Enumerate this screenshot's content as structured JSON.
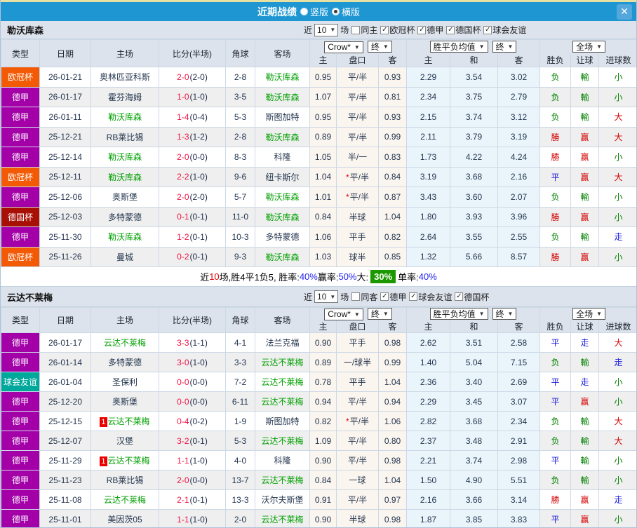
{
  "icons": {
    "dropdown_arrow": "▼",
    "check": "✓",
    "close": "✕"
  },
  "colors": {
    "titlebar": "#1e96d2",
    "badge": {
      "欧冠杯": "#f25a05",
      "德甲": "#a300a8",
      "德国杯": "#a91005",
      "球会友谊": "#00a79b"
    },
    "result": {
      "勝": "#d40000",
      "赢": "#d40000",
      "大": "#d40000",
      "平": "#2020dd",
      "走": "#2020dd",
      "负": "#008000",
      "輸": "#008000",
      "小": "#008000"
    }
  },
  "titlebar": {
    "title": "近期战绩",
    "radio_vertical": "竖版",
    "radio_horizontal": "横版"
  },
  "table_header": {
    "type": "类型",
    "date": "日期",
    "home": "主场",
    "score": "比分(半场)",
    "corner": "角球",
    "away": "客场",
    "dd_odds": "Crow*",
    "dd_final": "终",
    "dd_wdl": "胜平负均值",
    "dd_full": "全场",
    "sub_handicap": [
      "主",
      "盘口",
      "客"
    ],
    "sub_wdl": [
      "主",
      "和",
      "客"
    ],
    "sub_result": [
      "胜负",
      "让球",
      "进球数"
    ]
  },
  "sections": [
    {
      "team": "勒沃库森",
      "filter": {
        "recent": "近",
        "count": "10",
        "matches": "场",
        "checks": [
          {
            "label": "同主",
            "checked": false
          },
          {
            "label": "欧冠杯",
            "checked": true
          },
          {
            "label": "德甲",
            "checked": true
          },
          {
            "label": "德国杯",
            "checked": true
          },
          {
            "label": "球会友谊",
            "checked": true
          }
        ]
      },
      "rows": [
        {
          "comp": "欧冠杯",
          "date": "26-01-21",
          "home": "奥林匹亚科斯",
          "ft": "2-0",
          "ht": "2-0",
          "corner": "2-8",
          "away": "勒沃库森",
          "away_hl": true,
          "odds": [
            "0.95",
            "平/半",
            "0.93"
          ],
          "star": false,
          "eu": [
            "2.29",
            "3.54",
            "3.02"
          ],
          "res": [
            "负",
            "輸",
            "小"
          ]
        },
        {
          "comp": "德甲",
          "date": "26-01-17",
          "home": "霍芬海姆",
          "ft": "1-0",
          "ht": "1-0",
          "corner": "3-5",
          "away": "勒沃库森",
          "away_hl": true,
          "odds": [
            "1.07",
            "平/半",
            "0.81"
          ],
          "star": false,
          "eu": [
            "2.34",
            "3.75",
            "2.79"
          ],
          "res": [
            "负",
            "輸",
            "小"
          ]
        },
        {
          "comp": "德甲",
          "date": "26-01-11",
          "home": "勒沃库森",
          "home_hl": true,
          "ft": "1-4",
          "ht": "0-4",
          "corner": "5-3",
          "away": "斯图加特",
          "odds": [
            "0.95",
            "平/半",
            "0.93"
          ],
          "star": false,
          "eu": [
            "2.15",
            "3.74",
            "3.12"
          ],
          "res": [
            "负",
            "輸",
            "大"
          ]
        },
        {
          "comp": "德甲",
          "date": "25-12-21",
          "home": "RB莱比锡",
          "ft": "1-3",
          "ht": "1-2",
          "corner": "2-8",
          "away": "勒沃库森",
          "away_hl": true,
          "odds": [
            "0.89",
            "平/半",
            "0.99"
          ],
          "star": false,
          "eu": [
            "2.11",
            "3.79",
            "3.19"
          ],
          "res": [
            "勝",
            "赢",
            "大"
          ]
        },
        {
          "comp": "德甲",
          "date": "25-12-14",
          "home": "勒沃库森",
          "home_hl": true,
          "ft": "2-0",
          "ht": "0-0",
          "corner": "8-3",
          "away": "科隆",
          "odds": [
            "1.05",
            "半/一",
            "0.83"
          ],
          "star": false,
          "eu": [
            "1.73",
            "4.22",
            "4.24"
          ],
          "res": [
            "勝",
            "赢",
            "小"
          ]
        },
        {
          "comp": "欧冠杯",
          "date": "25-12-11",
          "home": "勒沃库森",
          "home_hl": true,
          "ft": "2-2",
          "ht": "1-0",
          "corner": "9-6",
          "away": "纽卡斯尔",
          "odds": [
            "1.04",
            "平/半",
            "0.84"
          ],
          "star": true,
          "eu": [
            "3.19",
            "3.68",
            "2.16"
          ],
          "res": [
            "平",
            "赢",
            "大"
          ]
        },
        {
          "comp": "德甲",
          "date": "25-12-06",
          "home": "奥斯堡",
          "ft": "2-0",
          "ht": "2-0",
          "corner": "5-7",
          "away": "勒沃库森",
          "away_hl": true,
          "odds": [
            "1.01",
            "平/半",
            "0.87"
          ],
          "star": true,
          "eu": [
            "3.43",
            "3.60",
            "2.07"
          ],
          "res": [
            "负",
            "輸",
            "小"
          ]
        },
        {
          "comp": "德国杯",
          "date": "25-12-03",
          "home": "多特蒙德",
          "ft": "0-1",
          "ht": "0-1",
          "corner": "11-0",
          "away": "勒沃库森",
          "away_hl": true,
          "odds": [
            "0.84",
            "半球",
            "1.04"
          ],
          "star": false,
          "eu": [
            "1.80",
            "3.93",
            "3.96"
          ],
          "res": [
            "勝",
            "赢",
            "小"
          ]
        },
        {
          "comp": "德甲",
          "date": "25-11-30",
          "home": "勒沃库森",
          "home_hl": true,
          "ft": "1-2",
          "ht": "0-1",
          "corner": "10-3",
          "away": "多特蒙德",
          "odds": [
            "1.06",
            "平手",
            "0.82"
          ],
          "star": false,
          "eu": [
            "2.64",
            "3.55",
            "2.55"
          ],
          "res": [
            "负",
            "輸",
            "走"
          ]
        },
        {
          "comp": "欧冠杯",
          "date": "25-11-26",
          "home": "曼城",
          "ft": "0-2",
          "ht": "0-1",
          "corner": "9-3",
          "away": "勒沃库森",
          "away_hl": true,
          "odds": [
            "1.03",
            "球半",
            "0.85"
          ],
          "star": false,
          "eu": [
            "1.32",
            "5.66",
            "8.57"
          ],
          "res": [
            "勝",
            "赢",
            "小"
          ]
        }
      ],
      "summary": [
        {
          "t": "近",
          "c": "k"
        },
        {
          "t": "10",
          "c": "r"
        },
        {
          "t": "场,胜4平1负5, 胜率:",
          "c": "k"
        },
        {
          "t": "40%",
          "c": "b"
        },
        {
          "t": " 赢率:",
          "c": "k"
        },
        {
          "t": "50%",
          "c": "b"
        },
        {
          "t": " 大:",
          "c": "k"
        },
        {
          "t": "30%",
          "c": "g"
        },
        {
          "t": " 单率:",
          "c": "k"
        },
        {
          "t": "40%",
          "c": "b"
        }
      ]
    },
    {
      "team": "云达不莱梅",
      "filter": {
        "recent": "近",
        "count": "10",
        "matches": "场",
        "checks": [
          {
            "label": "同客",
            "checked": false
          },
          {
            "label": "德甲",
            "checked": true
          },
          {
            "label": "球会友谊",
            "checked": true
          },
          {
            "label": "德国杯",
            "checked": true
          }
        ]
      },
      "rows": [
        {
          "comp": "德甲",
          "date": "26-01-17",
          "home": "云达不莱梅",
          "home_hl": true,
          "ft": "3-3",
          "ht": "1-1",
          "corner": "4-1",
          "away": "法兰克福",
          "odds": [
            "0.90",
            "平手",
            "0.98"
          ],
          "star": false,
          "eu": [
            "2.62",
            "3.51",
            "2.58"
          ],
          "res": [
            "平",
            "走",
            "大"
          ]
        },
        {
          "comp": "德甲",
          "date": "26-01-14",
          "home": "多特蒙德",
          "ft": "3-0",
          "ht": "1-0",
          "corner": "3-3",
          "away": "云达不莱梅",
          "away_hl": true,
          "odds": [
            "0.89",
            "一/球半",
            "0.99"
          ],
          "star": false,
          "eu": [
            "1.40",
            "5.04",
            "7.15"
          ],
          "res": [
            "负",
            "輸",
            "走"
          ]
        },
        {
          "comp": "球会友谊",
          "date": "26-01-04",
          "home": "圣保利",
          "ft": "0-0",
          "ht": "0-0",
          "corner": "7-2",
          "away": "云达不莱梅",
          "away_hl": true,
          "odds": [
            "0.78",
            "平手",
            "1.04"
          ],
          "star": false,
          "eu": [
            "2.36",
            "3.40",
            "2.69"
          ],
          "res": [
            "平",
            "走",
            "小"
          ]
        },
        {
          "comp": "德甲",
          "date": "25-12-20",
          "home": "奥斯堡",
          "ft": "0-0",
          "ht": "0-0",
          "corner": "6-11",
          "away": "云达不莱梅",
          "away_hl": true,
          "odds": [
            "0.94",
            "平/半",
            "0.94"
          ],
          "star": false,
          "eu": [
            "2.29",
            "3.45",
            "3.07"
          ],
          "res": [
            "平",
            "赢",
            "小"
          ]
        },
        {
          "comp": "德甲",
          "date": "25-12-15",
          "home": "云达不莱梅",
          "home_hl": true,
          "home_rc": "1",
          "ft": "0-4",
          "ht": "0-2",
          "corner": "1-9",
          "away": "斯图加特",
          "odds": [
            "0.82",
            "平/半",
            "1.06"
          ],
          "star": true,
          "eu": [
            "2.82",
            "3.68",
            "2.34"
          ],
          "res": [
            "负",
            "輸",
            "大"
          ]
        },
        {
          "comp": "德甲",
          "date": "25-12-07",
          "home": "汉堡",
          "ft": "3-2",
          "ht": "0-1",
          "corner": "5-3",
          "away": "云达不莱梅",
          "away_hl": true,
          "odds": [
            "1.09",
            "平/半",
            "0.80"
          ],
          "star": false,
          "eu": [
            "2.37",
            "3.48",
            "2.91"
          ],
          "res": [
            "负",
            "輸",
            "大"
          ]
        },
        {
          "comp": "德甲",
          "date": "25-11-29",
          "home": "云达不莱梅",
          "home_hl": true,
          "home_rc": "1",
          "ft": "1-1",
          "ht": "1-0",
          "corner": "4-0",
          "away": "科隆",
          "odds": [
            "0.90",
            "平/半",
            "0.98"
          ],
          "star": false,
          "eu": [
            "2.21",
            "3.74",
            "2.98"
          ],
          "res": [
            "平",
            "輸",
            "小"
          ]
        },
        {
          "comp": "德甲",
          "date": "25-11-23",
          "home": "RB莱比锡",
          "ft": "2-0",
          "ht": "0-0",
          "corner": "13-7",
          "away": "云达不莱梅",
          "away_hl": true,
          "odds": [
            "0.84",
            "一球",
            "1.04"
          ],
          "star": false,
          "eu": [
            "1.50",
            "4.90",
            "5.51"
          ],
          "res": [
            "负",
            "輸",
            "小"
          ]
        },
        {
          "comp": "德甲",
          "date": "25-11-08",
          "home": "云达不莱梅",
          "home_hl": true,
          "ft": "2-1",
          "ht": "0-1",
          "corner": "13-3",
          "away": "沃尔夫斯堡",
          "odds": [
            "0.91",
            "平/半",
            "0.97"
          ],
          "star": false,
          "eu": [
            "2.16",
            "3.66",
            "3.14"
          ],
          "res": [
            "勝",
            "赢",
            "走"
          ]
        },
        {
          "comp": "德甲",
          "date": "25-11-01",
          "home": "美因茨05",
          "ft": "1-1",
          "ht": "1-0",
          "corner": "2-0",
          "away": "云达不莱梅",
          "away_hl": true,
          "odds": [
            "0.90",
            "半球",
            "0.98"
          ],
          "star": false,
          "eu": [
            "1.87",
            "3.85",
            "3.83"
          ],
          "res": [
            "平",
            "赢",
            "小"
          ]
        }
      ]
    }
  ]
}
